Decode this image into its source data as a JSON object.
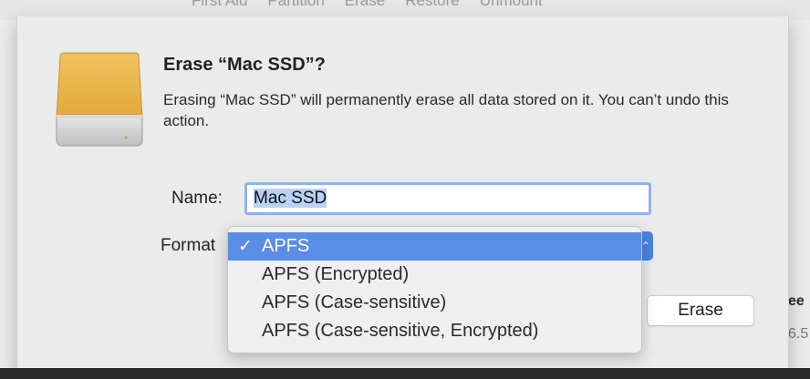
{
  "toolbar": {
    "items": [
      "First Aid",
      "Partition",
      "Erase",
      "Restore",
      "Unmount"
    ]
  },
  "dialog": {
    "title": "Erase “Mac SSD”?",
    "message": "Erasing “Mac SSD” will permanently erase all data stored on it. You can’t undo this action.",
    "name_label": "Name:",
    "name_value": "Mac SSD",
    "format_label": "Format",
    "erase_label": "Erase"
  },
  "format_menu": {
    "check_glyph": "✓",
    "options": [
      {
        "label": "APFS",
        "selected": true
      },
      {
        "label": "APFS (Encrypted)",
        "selected": false
      },
      {
        "label": "APFS (Case-sensitive)",
        "selected": false
      },
      {
        "label": "APFS (Case-sensitive, Encrypted)",
        "selected": false
      }
    ]
  },
  "background_side": {
    "line1": "ee",
    "line2": "6.5"
  },
  "colors": {
    "accent": "#5a8de6",
    "focus_ring": "#8fb1ec"
  },
  "icons": {
    "disk": "internal-disk-icon",
    "chevron": "popup-chevron-icon"
  }
}
